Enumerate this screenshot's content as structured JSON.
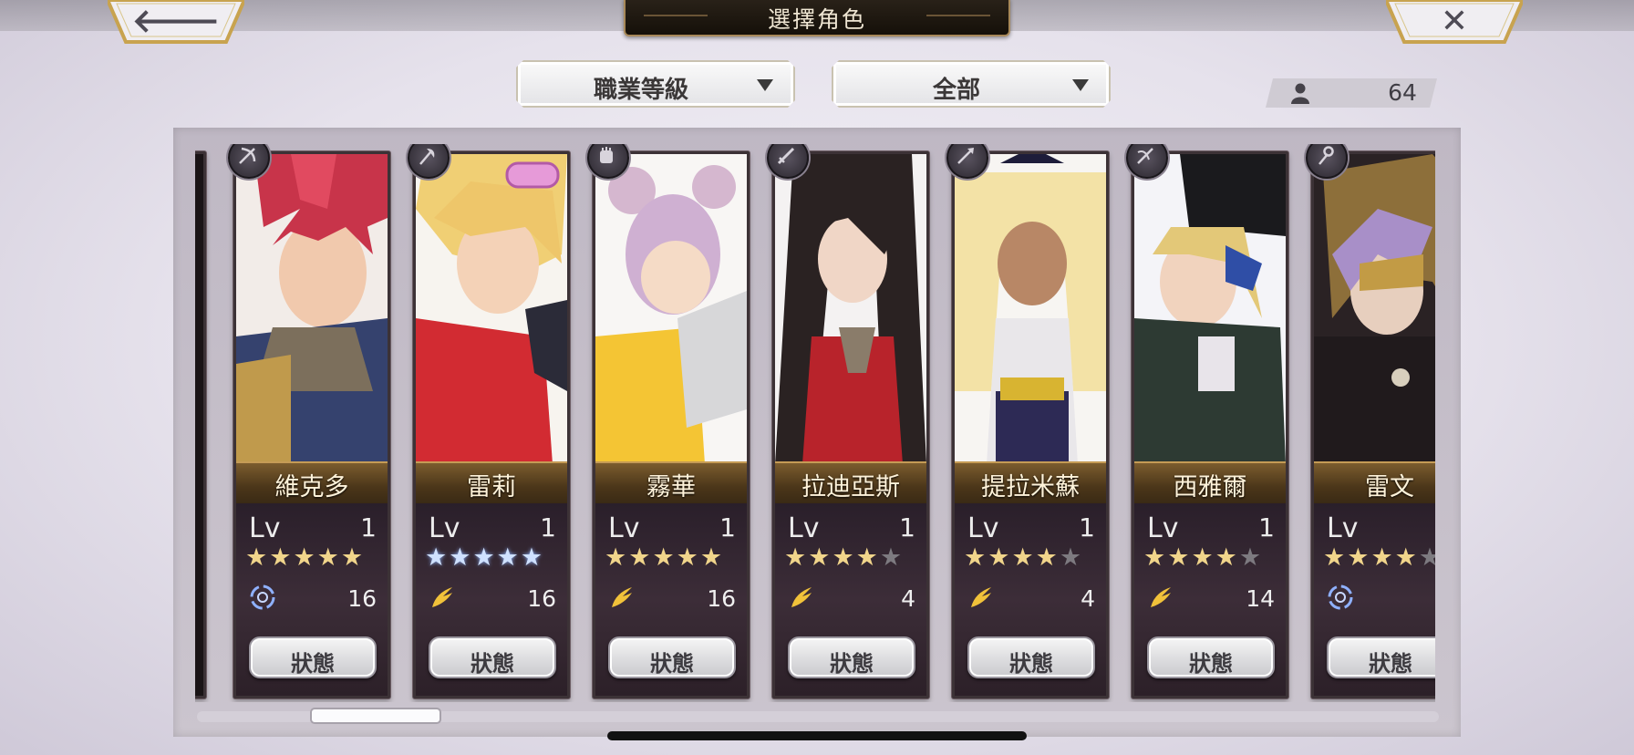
{
  "header": {
    "title": "選擇角色",
    "back_label": "🡐",
    "close_label": "✕"
  },
  "filters": {
    "class_filter": "職業等級",
    "element_filter": "全部"
  },
  "character_count": "64",
  "level_label": "Lv",
  "status_label": "狀態",
  "characters": [
    {
      "name": "維克多",
      "level": "1",
      "stars": 5,
      "rarity_color": "gold",
      "element": "wind",
      "value": "16"
    },
    {
      "name": "雷莉",
      "level": "1",
      "stars": 5,
      "rarity_color": "blue",
      "element": "light",
      "value": "16"
    },
    {
      "name": "霧華",
      "level": "1",
      "stars": 5,
      "rarity_color": "gold",
      "element": "light",
      "value": "16"
    },
    {
      "name": "拉迪亞斯",
      "level": "1",
      "stars": 4,
      "rarity_color": "gold",
      "element": "light",
      "value": "4"
    },
    {
      "name": "提拉米蘇",
      "level": "1",
      "stars": 4,
      "rarity_color": "gold",
      "element": "light",
      "value": "4"
    },
    {
      "name": "西雅爾",
      "level": "1",
      "stars": 4,
      "rarity_color": "gold",
      "element": "light",
      "value": "14"
    },
    {
      "name": "雷文",
      "level": "",
      "stars": 4,
      "rarity_color": "gold",
      "element": "wind",
      "value": ""
    }
  ],
  "colors": {
    "frame": "#3c3236",
    "nameplate": "#4b3619",
    "star_gold": "#f1d58b",
    "star_blue": "#cfe1ff",
    "star_empty": "#7d7a80"
  }
}
